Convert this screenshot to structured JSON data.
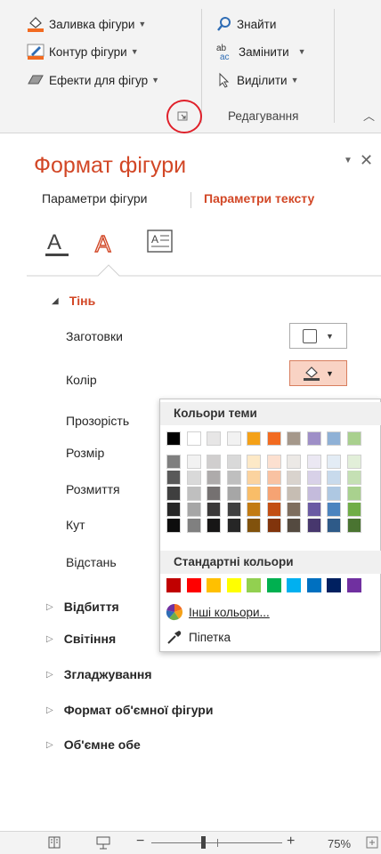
{
  "ribbon": {
    "shape_fill": "Заливка фігури",
    "shape_outline": "Контур фігури",
    "shape_effects": "Ефекти для фігур",
    "find": "Знайти",
    "replace": "Замінити",
    "select": "Виділити",
    "group_editing": "Редагування"
  },
  "pane": {
    "title": "Формат фігури",
    "tab_shape": "Параметри фігури",
    "tab_text": "Параметри тексту",
    "section_shadow": "Тінь",
    "presets": "Заготовки",
    "color": "Колір",
    "transparency": "Прозорість",
    "size": "Розмір",
    "blur": "Розмиття",
    "angle": "Кут",
    "distance": "Відстань",
    "section_reflection": "Відбиття",
    "section_glow": "Світіння",
    "section_soft_edges": "Згладжування",
    "section_3d_format": "Формат об'ємної фігури",
    "section_3d_rotation": "Об'ємне обе"
  },
  "color_popup": {
    "theme_colors": "Кольори теми",
    "standard_colors": "Стандартні кольори",
    "more_colors": "Інші кольори...",
    "eyedropper": "Піпетка",
    "theme_top": [
      "#000000",
      "#ffffff",
      "#e7e6e6",
      "#f2f2f2",
      "#f4a118",
      "#f26b21",
      "#a5988b",
      "#9e8fc7",
      "#8fb1d6",
      "#a9d08e"
    ],
    "theme_shades": [
      [
        "#7f7f7f",
        "#f2f2f2",
        "#d0cece",
        "#d9d9d9",
        "#fde9c7",
        "#fce0d0",
        "#ece9e6",
        "#ebe8f3",
        "#e3ecf5",
        "#e2efd9"
      ],
      [
        "#595959",
        "#d9d9d9",
        "#aeabab",
        "#bfbfbf",
        "#fbd39f",
        "#f9c2a2",
        "#d9d3cd",
        "#d8d1e8",
        "#c8daec",
        "#c5e0b4"
      ],
      [
        "#3f3f3f",
        "#bfbfbf",
        "#757171",
        "#a6a6a6",
        "#f9bd68",
        "#f6a373",
        "#c6bdb3",
        "#c4bbdc",
        "#aec8e2",
        "#a9d18e"
      ],
      [
        "#262626",
        "#a6a6a6",
        "#3a3838",
        "#404040",
        "#c27b13",
        "#c24e13",
        "#7e6e5f",
        "#6a5aa3",
        "#4b84bf",
        "#70ad47"
      ],
      [
        "#0d0d0d",
        "#808080",
        "#171616",
        "#262626",
        "#81520c",
        "#81340c",
        "#544a40",
        "#47376d",
        "#2e5a88",
        "#4a7431"
      ]
    ],
    "standard": [
      "#c00000",
      "#ff0000",
      "#ffc000",
      "#ffff00",
      "#92d050",
      "#00b050",
      "#00b0f0",
      "#0070c0",
      "#002060",
      "#7030a0"
    ]
  },
  "status": {
    "zoom": "75%"
  },
  "colors": {
    "accent": "#d24726",
    "highlight_circle": "#e0202a"
  }
}
